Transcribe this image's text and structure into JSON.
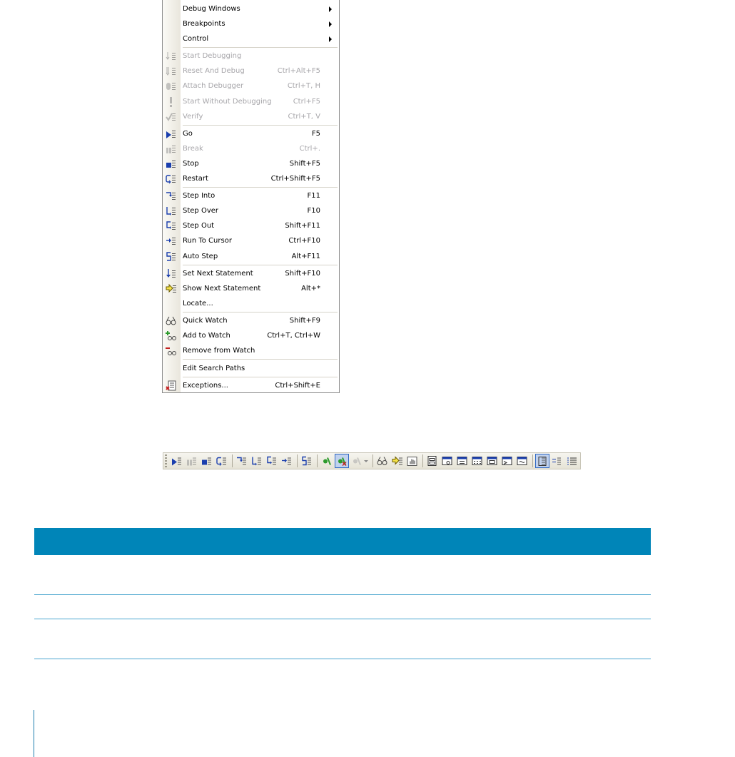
{
  "menu": {
    "items": [
      {
        "label": "Debug Windows",
        "shortcut": "",
        "submenu": true,
        "disabled": false,
        "icon": "none"
      },
      {
        "label": "Breakpoints",
        "shortcut": "",
        "submenu": true,
        "disabled": false,
        "icon": "none"
      },
      {
        "label": "Control",
        "shortcut": "",
        "submenu": true,
        "disabled": false,
        "icon": "none"
      },
      {
        "label": "Start Debugging",
        "shortcut": "",
        "submenu": false,
        "disabled": true,
        "icon": "start-debugging-icon"
      },
      {
        "label": "Reset And Debug",
        "shortcut": "Ctrl+Alt+F5",
        "submenu": false,
        "disabled": true,
        "icon": "reset-debug-icon"
      },
      {
        "label": "Attach Debugger",
        "shortcut": "Ctrl+T, H",
        "submenu": false,
        "disabled": true,
        "icon": "attach-debugger-icon"
      },
      {
        "label": "Start Without Debugging",
        "shortcut": "Ctrl+F5",
        "submenu": false,
        "disabled": true,
        "icon": "exclamation-icon"
      },
      {
        "label": "Verify",
        "shortcut": "Ctrl+T, V",
        "submenu": false,
        "disabled": true,
        "icon": "verify-icon"
      },
      {
        "label": "Go",
        "shortcut": "F5",
        "submenu": false,
        "disabled": false,
        "icon": "go-icon"
      },
      {
        "label": "Break",
        "shortcut": "Ctrl+.",
        "submenu": false,
        "disabled": true,
        "icon": "break-icon"
      },
      {
        "label": "Stop",
        "shortcut": "Shift+F5",
        "submenu": false,
        "disabled": false,
        "icon": "stop-icon"
      },
      {
        "label": "Restart",
        "shortcut": "Ctrl+Shift+F5",
        "submenu": false,
        "disabled": false,
        "icon": "restart-icon"
      },
      {
        "label": "Step Into",
        "shortcut": "F11",
        "submenu": false,
        "disabled": false,
        "icon": "step-into-icon"
      },
      {
        "label": "Step Over",
        "shortcut": "F10",
        "submenu": false,
        "disabled": false,
        "icon": "step-over-icon"
      },
      {
        "label": "Step Out",
        "shortcut": "Shift+F11",
        "submenu": false,
        "disabled": false,
        "icon": "step-out-icon"
      },
      {
        "label": "Run To Cursor",
        "shortcut": "Ctrl+F10",
        "submenu": false,
        "disabled": false,
        "icon": "run-to-cursor-icon"
      },
      {
        "label": "Auto Step",
        "shortcut": "Alt+F11",
        "submenu": false,
        "disabled": false,
        "icon": "auto-step-icon"
      },
      {
        "label": "Set Next Statement",
        "shortcut": "Shift+F10",
        "submenu": false,
        "disabled": false,
        "icon": "set-next-statement-icon"
      },
      {
        "label": "Show Next Statement",
        "shortcut": "Alt+*",
        "submenu": false,
        "disabled": false,
        "icon": "show-next-statement-icon"
      },
      {
        "label": "Locate...",
        "shortcut": "",
        "submenu": false,
        "disabled": false,
        "icon": "none"
      },
      {
        "label": "Quick Watch",
        "shortcut": "Shift+F9",
        "submenu": false,
        "disabled": false,
        "icon": "glasses-icon"
      },
      {
        "label": "Add to Watch",
        "shortcut": "Ctrl+T, Ctrl+W",
        "submenu": false,
        "disabled": false,
        "icon": "add-watch-icon"
      },
      {
        "label": "Remove from Watch",
        "shortcut": "",
        "submenu": false,
        "disabled": false,
        "icon": "remove-watch-icon"
      },
      {
        "label": "Edit Search Paths",
        "shortcut": "",
        "submenu": false,
        "disabled": false,
        "icon": "none"
      },
      {
        "label": "Exceptions...",
        "shortcut": "Ctrl+Shift+E",
        "submenu": false,
        "disabled": false,
        "icon": "exceptions-icon"
      }
    ]
  },
  "toolbar": {
    "buttons": [
      "go-icon",
      "break-icon",
      "stop-icon",
      "restart-icon",
      "|",
      "step-into-icon",
      "step-over-icon",
      "step-out-icon",
      "run-to-cursor-icon",
      "|",
      "auto-step-icon",
      "|",
      "toggle-breakpoint-icon",
      "clear-breakpoints-icon",
      "breakpoint-dropdown-icon",
      "|",
      "glasses-icon",
      "show-next-statement-icon",
      "pointer-hand-icon",
      "|",
      "call-stack-icon",
      "watch-window-icon",
      "locals-window-icon",
      "memory-window-icon",
      "registers-window-icon",
      "output-window-icon",
      "disassembly-window-icon",
      "|",
      "source-mode-icon",
      "mixed-mode-icon",
      "disassembly-mode-icon"
    ],
    "pressed": [
      "clear-breakpoints-icon",
      "source-mode-icon"
    ]
  },
  "colors": {
    "table_header": "#0085b8",
    "table_rule": "#4aa6cf",
    "accent_blue": "#1b3fae",
    "disabled_text": "#a7a6aa"
  }
}
